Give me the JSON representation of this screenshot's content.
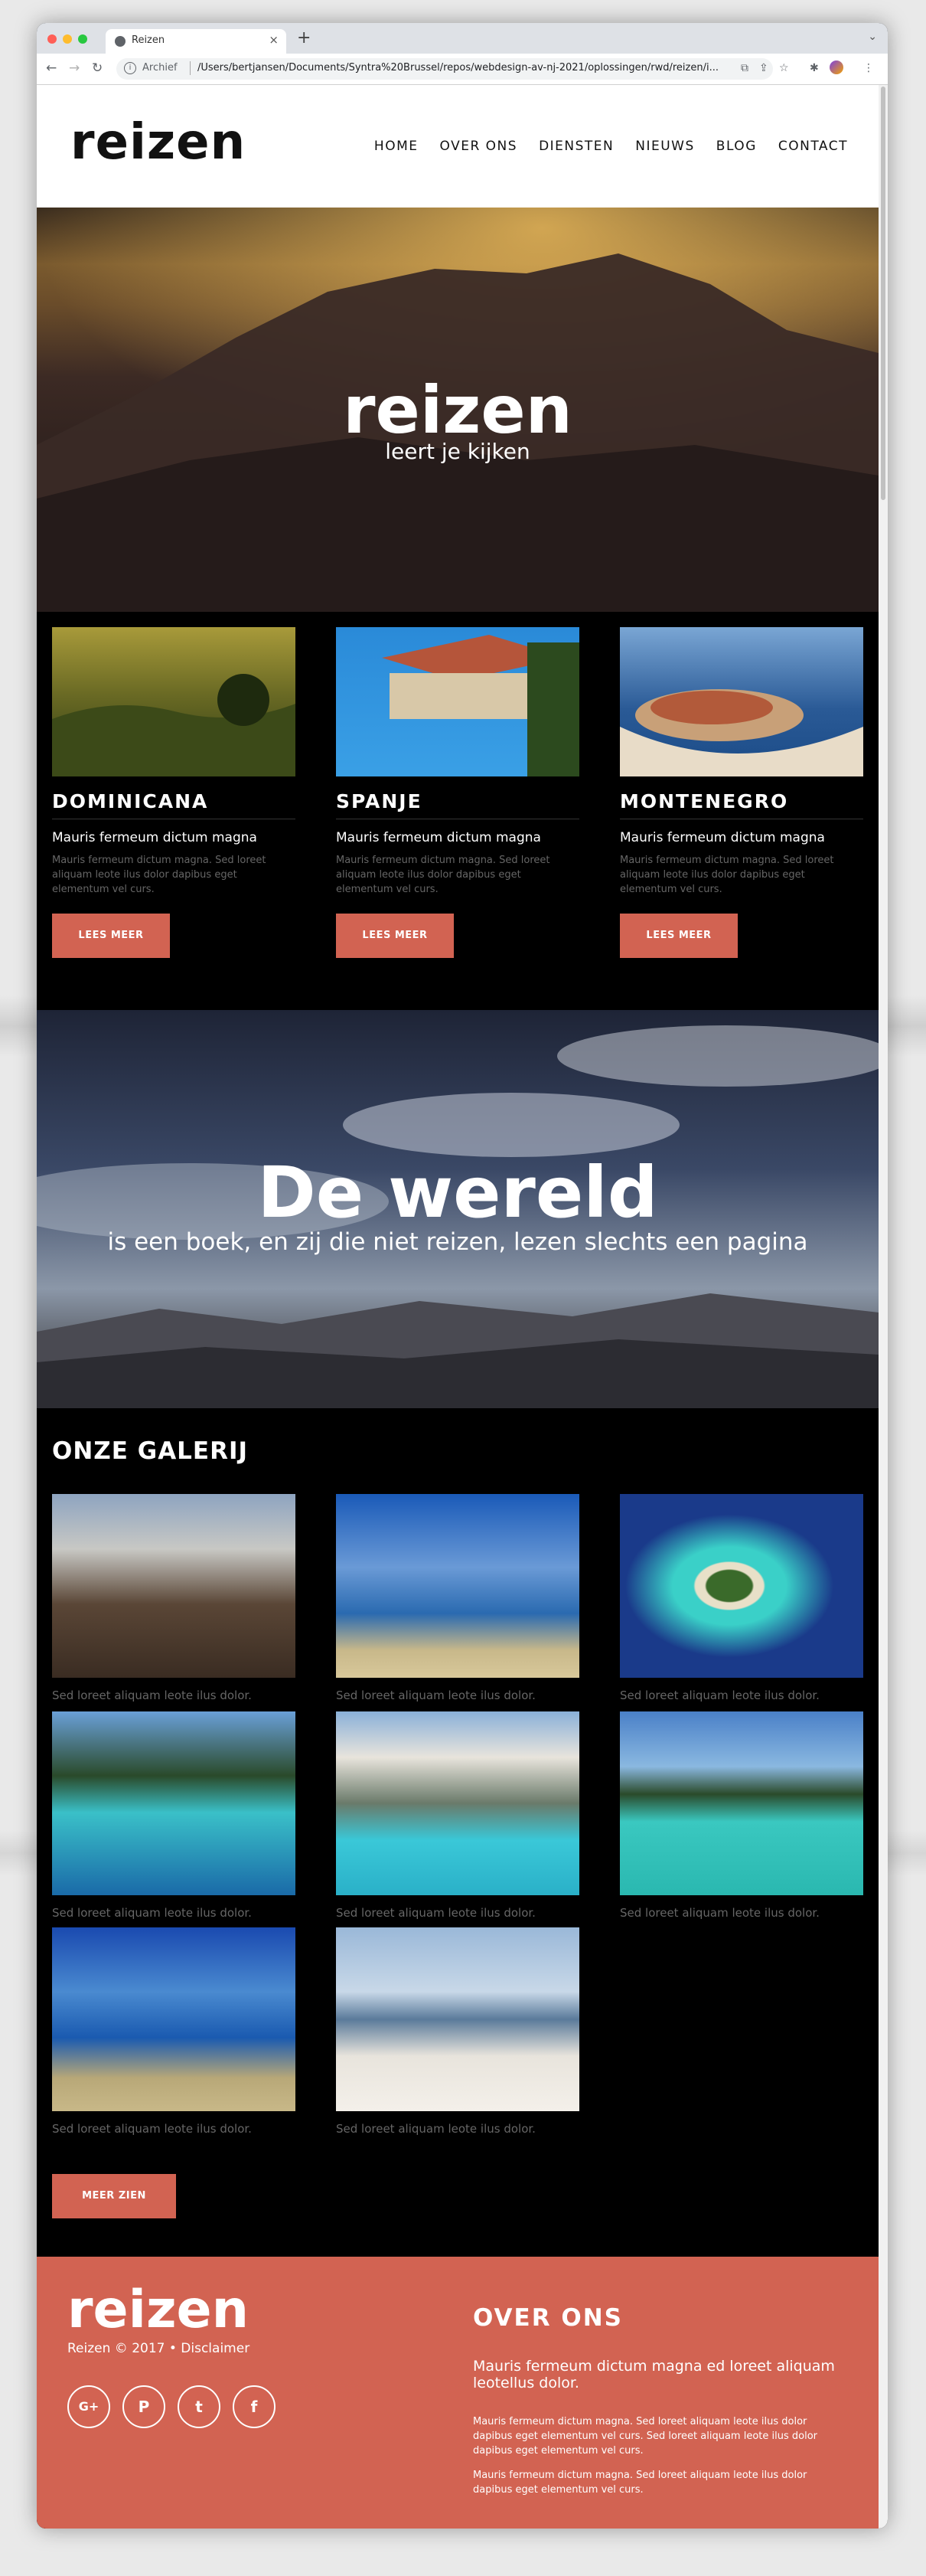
{
  "browser": {
    "tab_title": "Reizen",
    "address_chip": "Archief",
    "url": "/Users/bertjansen/Documents/Syntra%20Brussel/repos/webdesign-av-nj-2021/oplossingen/rwd/reizen/i...",
    "colors": {
      "chrome": "#dee1e6",
      "close": "#ff5f57",
      "min": "#febc2e",
      "max": "#28c840"
    }
  },
  "header": {
    "logo": "reizen",
    "nav": [
      "HOME",
      "OVER ONS",
      "DIENSTEN",
      "NIEUWS",
      "BLOG",
      "CONTACT"
    ]
  },
  "hero": {
    "title": "reizen",
    "subtitle": "leert je kijken"
  },
  "destinations": [
    {
      "name": "DOMINICANA",
      "subtitle": "Mauris fermeum dictum magna",
      "body": "Mauris fermeum dictum magna. Sed loreet aliquam leote ilus dolor dapibus eget elementum vel curs.",
      "button": "LEES MEER"
    },
    {
      "name": "SPANJE",
      "subtitle": "Mauris fermeum dictum magna",
      "body": "Mauris fermeum dictum magna. Sed loreet aliquam leote ilus dolor dapibus eget elementum vel curs.",
      "button": "LEES MEER"
    },
    {
      "name": "MONTENEGRO",
      "subtitle": "Mauris fermeum dictum magna",
      "body": "Mauris fermeum dictum magna. Sed loreet aliquam leote ilus dolor dapibus eget elementum vel curs.",
      "button": "LEES MEER"
    }
  ],
  "world": {
    "title": "De wereld",
    "subtitle": "is een boek, en zij die niet reizen, lezen slechts een pagina"
  },
  "gallery": {
    "title": "ONZE GALERIJ",
    "items": [
      {
        "caption": "Sed loreet aliquam leote ilus dolor."
      },
      {
        "caption": "Sed loreet aliquam leote ilus dolor."
      },
      {
        "caption": "Sed loreet aliquam leote ilus dolor."
      },
      {
        "caption": "Sed loreet aliquam leote ilus dolor."
      },
      {
        "caption": "Sed loreet aliquam leote ilus dolor."
      },
      {
        "caption": "Sed loreet aliquam leote ilus dolor."
      },
      {
        "caption": "Sed loreet aliquam leote ilus dolor."
      },
      {
        "caption": "Sed loreet aliquam leote ilus dolor."
      }
    ],
    "more_button": "MEER ZIEN"
  },
  "footer": {
    "logo": "reizen",
    "copyright": "Reizen © 2017 • Disclaimer",
    "social": [
      "G+",
      "P",
      "t",
      "f"
    ],
    "about_title": "OVER ONS",
    "about_lead": "Mauris fermeum dictum magna ed loreet aliquam leotellus dolor.",
    "about_p1": "Mauris fermeum dictum magna. Sed loreet aliquam leote ilus dolor dapibus eget elementum vel curs. Sed loreet aliquam leote ilus dolor dapibus eget elementum vel curs.",
    "about_p2": "Mauris fermeum dictum magna. Sed loreet aliquam leote ilus dolor dapibus eget elementum vel curs.",
    "accent": "#d26352"
  }
}
